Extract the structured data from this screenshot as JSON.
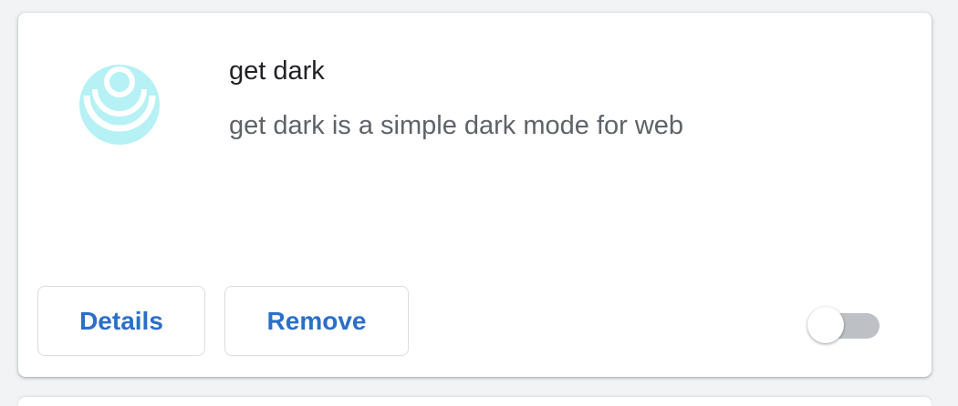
{
  "extension": {
    "name": "get dark",
    "description": "get dark is a simple dark mode for web",
    "icon": "get-dark-ripple-icon",
    "icon_color": "#b5f1f5",
    "enabled": false
  },
  "actions": {
    "details_label": "Details",
    "remove_label": "Remove"
  },
  "colors": {
    "accent": "#1a73e8",
    "toggle_off_track": "#bdc1c6",
    "title": "#202124",
    "description": "#5f6368"
  }
}
